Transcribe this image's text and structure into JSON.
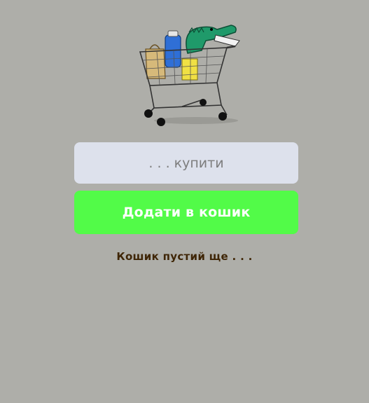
{
  "illustration": {
    "icon": "crocodile-shopping-cart-illustration"
  },
  "form": {
    "input_value": "",
    "input_placeholder": ". . . купити",
    "add_button_label": "Додати в кошик"
  },
  "cart": {
    "empty_message": "Кошик пустий ще . . ."
  },
  "colors": {
    "background": "#aeaea9",
    "input_background": "#dde1ec",
    "button_background": "#52fb48",
    "button_text": "#ffffff",
    "message_text": "#3f2607"
  }
}
